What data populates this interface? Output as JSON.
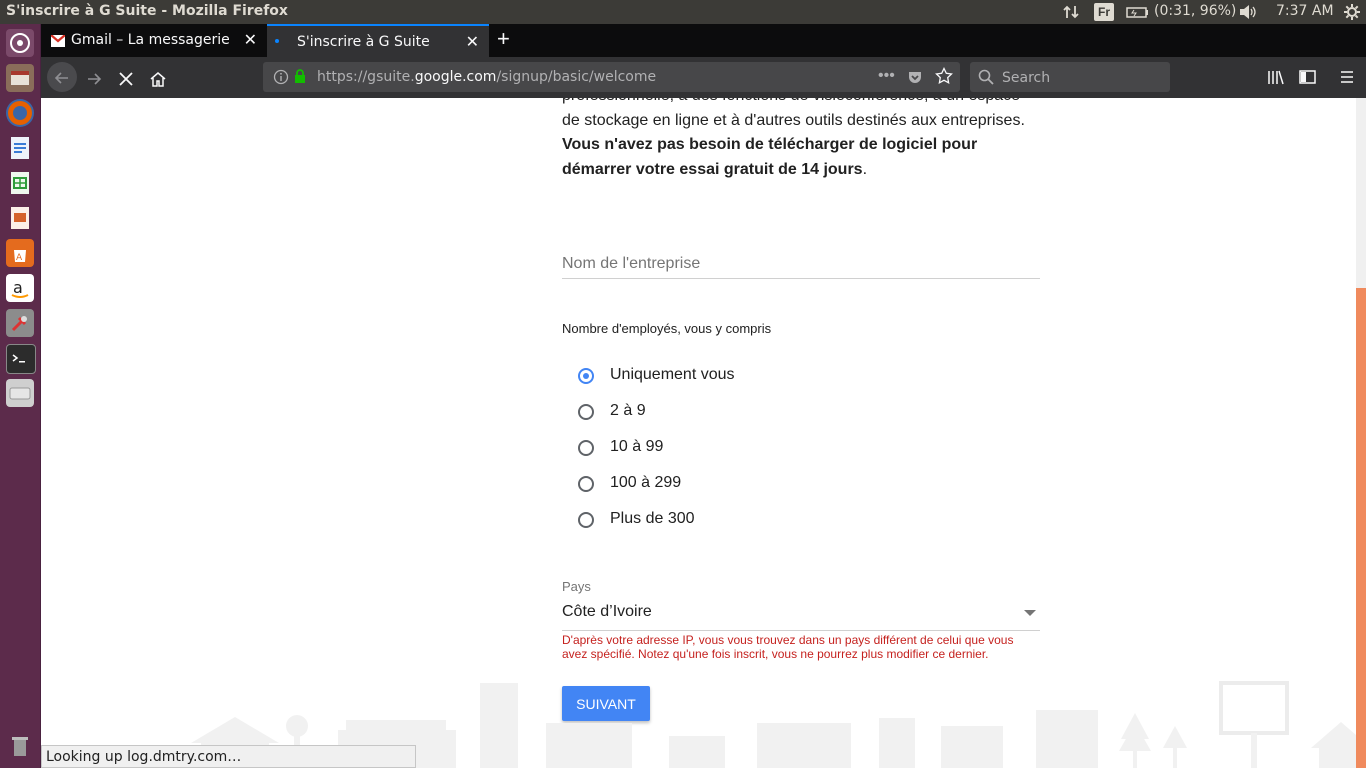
{
  "window": {
    "title": "S'inscrire à G Suite - Mozilla Firefox"
  },
  "panel": {
    "network_icon": "network-updown-icon",
    "keyboard_layout": "Fr",
    "battery": "(0:31, 96%)",
    "volume_icon": "volume-icon",
    "clock": "7:37 AM",
    "settings_icon": "gear-icon"
  },
  "launcher": {
    "items": [
      "ubuntu-dash-icon",
      "files-icon",
      "firefox-icon",
      "writer-icon",
      "calc-icon",
      "impress-icon",
      "software-center-icon",
      "amazon-icon",
      "system-settings-icon",
      "terminal-icon",
      "disk-icon",
      "trash-icon"
    ]
  },
  "tabs": [
    {
      "label": "Gmail – La messagerie av",
      "icon": "gmail-icon",
      "active": false
    },
    {
      "label": "S'inscrire à G Suite",
      "icon": "loading-dot-icon",
      "active": true
    }
  ],
  "nav": {
    "url_prefix": "https://gsuite.",
    "url_domain": "google.com",
    "url_path": "/signup/basic/welcome",
    "search_placeholder": "Search"
  },
  "page": {
    "intro_line1": "professionnelle, à des fonctions de visioconférence, à un espace de",
    "intro_line2": "stockage en ligne et à d'autres outils destinés aux entreprises.",
    "intro_bold": "Vous n'avez pas besoin de télécharger de logiciel pour démarrer votre essai gratuit de 14 jours",
    "intro_end": ".",
    "company_placeholder": "Nom de l'entreprise",
    "employees_label": "Nombre d'employés, vous y compris",
    "employee_options": [
      "Uniquement vous",
      "2 à 9",
      "10 à 99",
      "100 à 299",
      "Plus de 300"
    ],
    "selected_option": "Uniquement vous",
    "country_label": "Pays",
    "country_value": "Côte d’Ivoire",
    "country_warning": "D'après votre adresse IP, vous vous trouvez dans un pays différent de celui que vous avez spécifié. Notez qu'une fois inscrit, vous ne pourrez plus modifier ce dernier.",
    "next_button": "SUIVANT"
  },
  "status": {
    "text": "Looking up log.dmtry.com…"
  },
  "colors": {
    "accent": "#4285f4",
    "warning": "#c5221f",
    "scroll_thumb": "#f08a5d",
    "launcher": "#5c2b4b"
  }
}
